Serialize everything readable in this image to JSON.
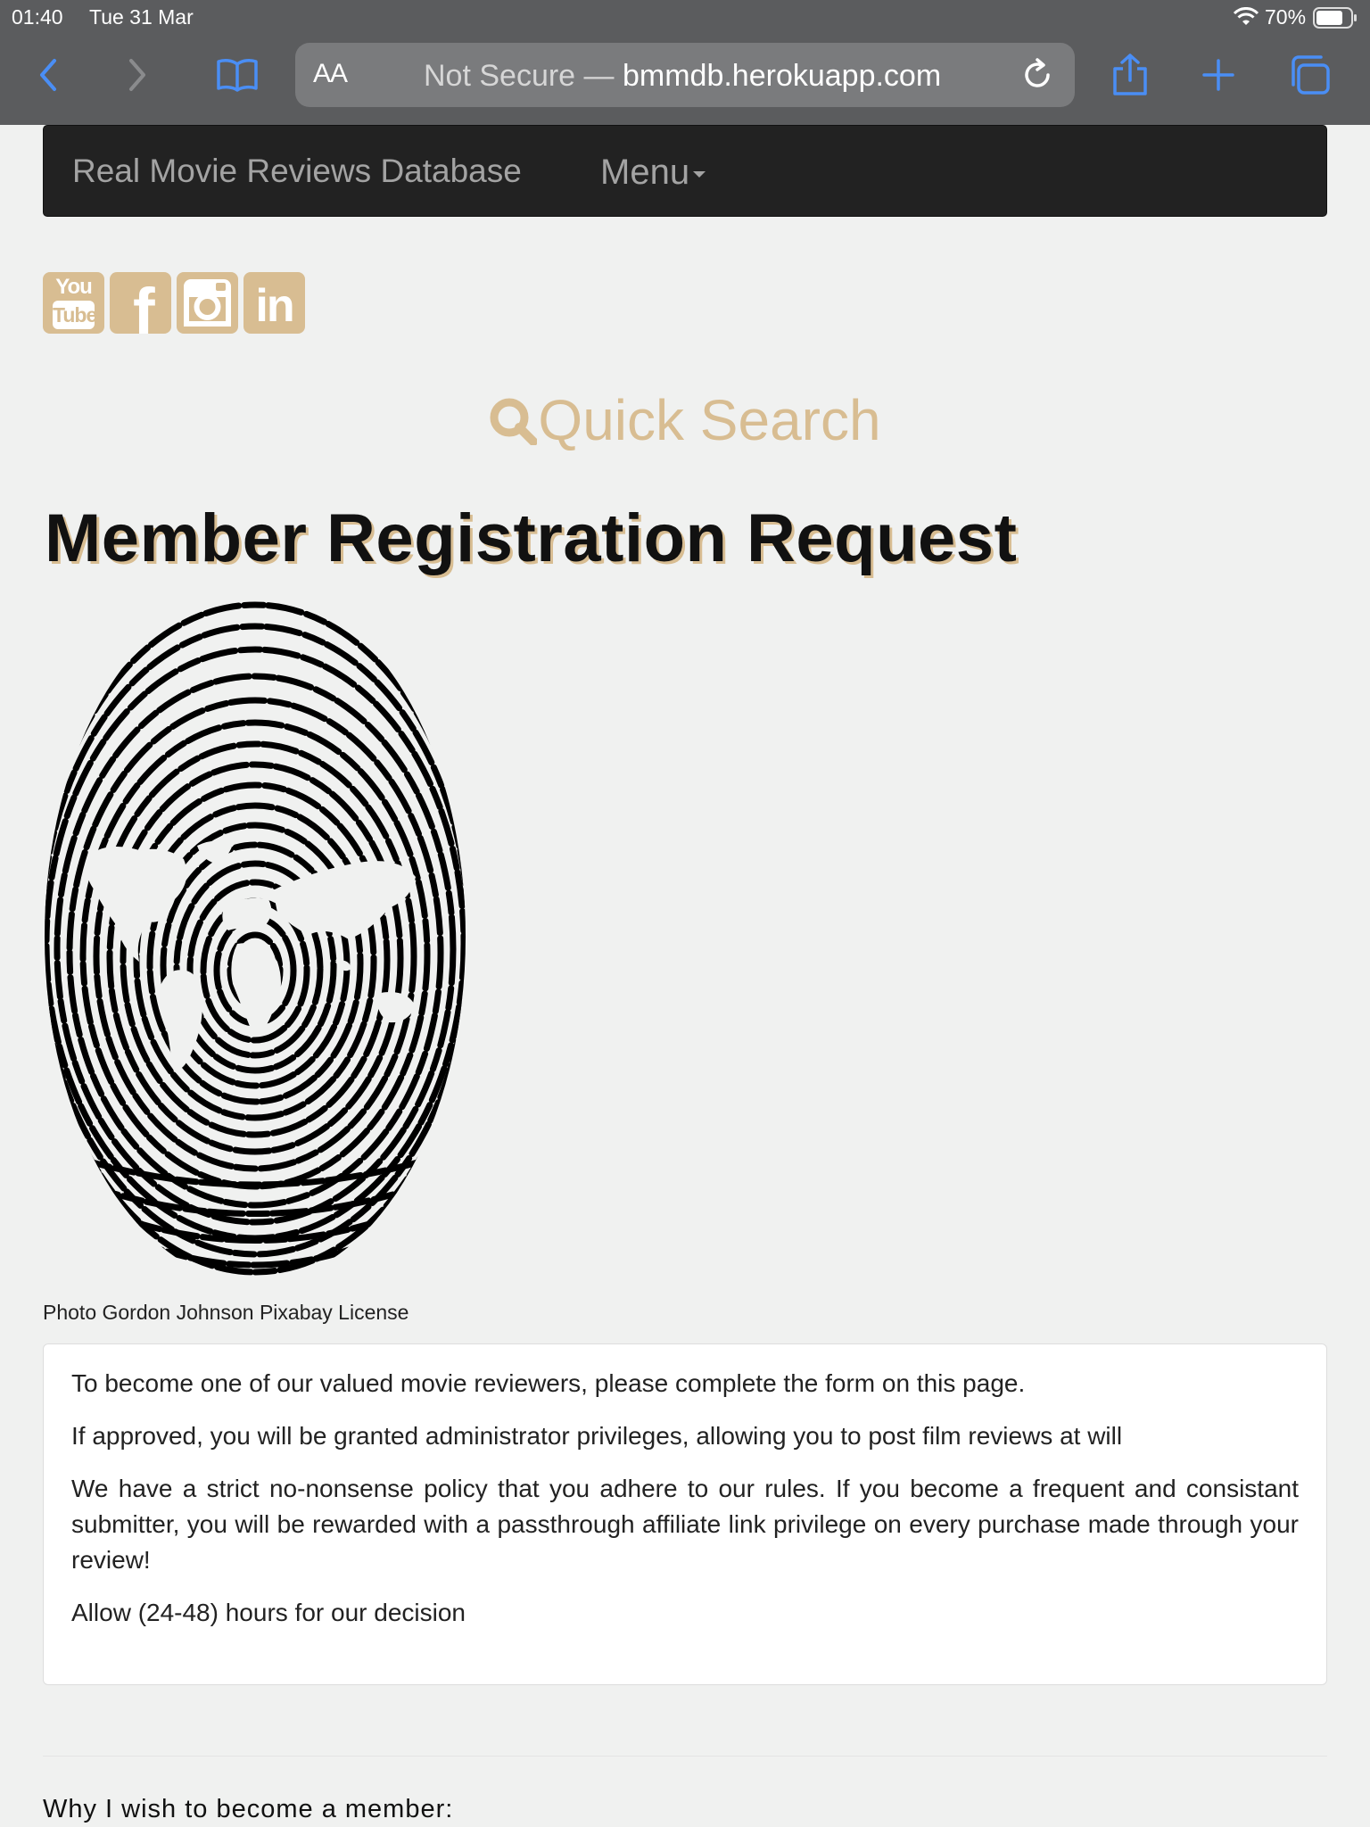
{
  "status_bar": {
    "time": "01:40",
    "date": "Tue 31 Mar",
    "battery": "70%"
  },
  "browser": {
    "aa_label": "AA",
    "security": "Not Secure —",
    "domain": "bmmdb.herokuapp.com"
  },
  "navbar": {
    "brand": "Real Movie Reviews Database",
    "menu": "Menu"
  },
  "social": {
    "youtube_top": "You",
    "youtube_bottom": "Tube",
    "facebook": "f",
    "linkedin": "in"
  },
  "quick_search": "Quick Search",
  "page_title": "Member Registration Request",
  "image_caption": "Photo Gordon Johnson Pixabay License",
  "info": {
    "p1": "To become one of our valued movie reviewers, please complete the form on this page.",
    "p2": "If approved, you will be granted administrator privileges, allowing you to post film reviews at will",
    "p3": "We have a strict no-nonsense policy that you adhere to our rules. If you become a frequent and consistant submitter, you will be rewarded with a passthrough affiliate link privilege on every purchase made through your review!",
    "p4": "Allow (24-48) hours for our decision"
  },
  "form": {
    "why_label": "Why I wish to become a member:"
  },
  "colors": {
    "accent": "#d8bd92",
    "navbar": "#222222",
    "browser_chrome": "#5b5c5e",
    "ios_blue": "#4a8ef5"
  }
}
